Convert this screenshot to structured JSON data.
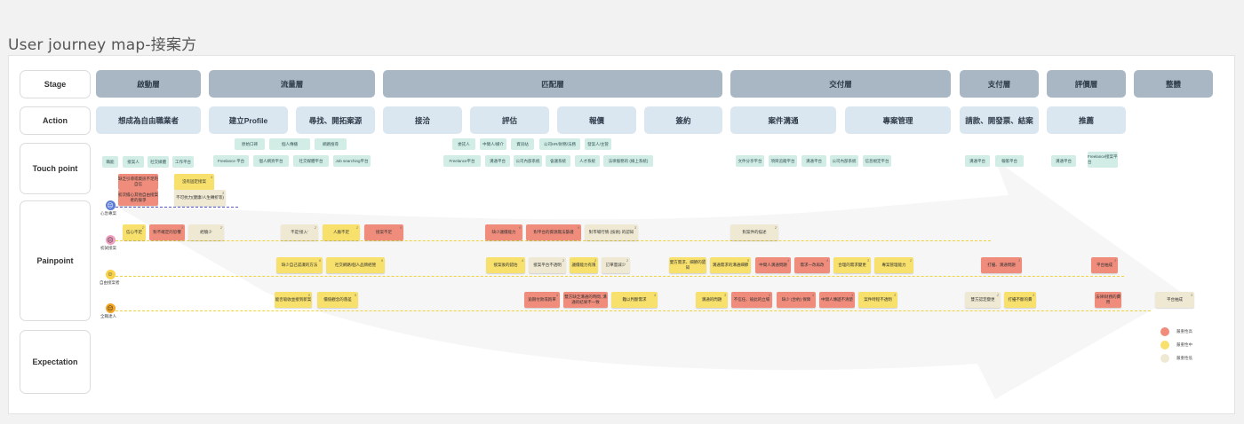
{
  "page": {
    "title": "User journey map-接案方"
  },
  "row_labels": {
    "stage": "Stage",
    "action": "Action",
    "touchpoint": "Touch point",
    "painpoint": "Painpoint",
    "expectation": "Expectation"
  },
  "stages": [
    "啟動層",
    "流量層",
    "匹配層",
    "交付層",
    "支付層",
    "評價層",
    "整體"
  ],
  "actions": [
    "想成為自由職業者",
    "建立Profile",
    "尋找、開拓案源",
    "接洽",
    "評估",
    "報價",
    "簽約",
    "案件溝通",
    "專案管理",
    "請款、開發票、結案",
    "推薦"
  ],
  "touchpoints": [
    "職能",
    "接案人",
    "社交媒體",
    "工作平台",
    "原始口碑",
    "個人傳播",
    "網路搜尋",
    "Freelance 平台",
    "個人網頁平台",
    "社交媒體平台",
    "Job searching平台",
    "委託人",
    "中間人/媒介",
    "資訊站",
    "公司HR/財務/法務",
    "發案人/主管",
    "Freelance平台",
    "溝通平台",
    "公司內部系統",
    "會議系統",
    "人才系統",
    "法律服務的 (線上系統)",
    "文件分享平台",
    "項目追蹤平台",
    "溝通平台",
    "公司內部系統",
    "信息規定平台",
    "溝通平台",
    "報帳平台",
    "溝通平台",
    "Freelance接案平台"
  ],
  "personas": [
    "心急專案",
    "初試接案",
    "自由接案者",
    "全職達人"
  ],
  "notes": [
    "缺乏引導或資訊不足的自信",
    "沒有固定接案",
    "初次擔心其他自由接案者的競爭",
    "不可抗力(健康/人生轉折等)",
    "信心不足",
    "對不確定的恐懼",
    "經驗少",
    "不是'接入'",
    "人脈不足",
    "接案不足",
    "缺少議價能力",
    "對平台的資源無法篩選",
    "對市場行情 (技術) 的認知",
    "對案件的描述",
    "缺少自己認識的方法",
    "社交網路/個人品牌經營",
    "接案後的錯估",
    "接案平台不透明",
    "議價能力有限",
    "訂單量減少",
    "雙方需求、細節的認知",
    "溝通需求的溝通細節",
    "中間人溝通問題",
    "需求一改再改",
    "合理的需求變更",
    "專案管理能力",
    "打擾、溝通問題",
    "平台抽成",
    "能否吸收並接到新案",
    "價值觀念的落差",
    "逾期付款或跑單",
    "雙方缺乏溝通的時間, 溝通的結果不一致",
    "難以判斷需求",
    "溝通的問題",
    "不信任、彼此的立場",
    "缺少 (合約) 保障",
    "中間人傳遞不清楚",
    "案件時程不透明",
    "雙方認定變更",
    "打擾不斷的費",
    "法律/財務的費用",
    "平台抽成",
    "對信任的維持",
    "信任的問題"
  ],
  "legend": [
    {
      "label": "嚴重性高",
      "color": "#ef8c7b"
    },
    {
      "label": "嚴重性中",
      "color": "#f7e06b"
    },
    {
      "label": "嚴重性低",
      "color": "#efe9d3"
    }
  ]
}
